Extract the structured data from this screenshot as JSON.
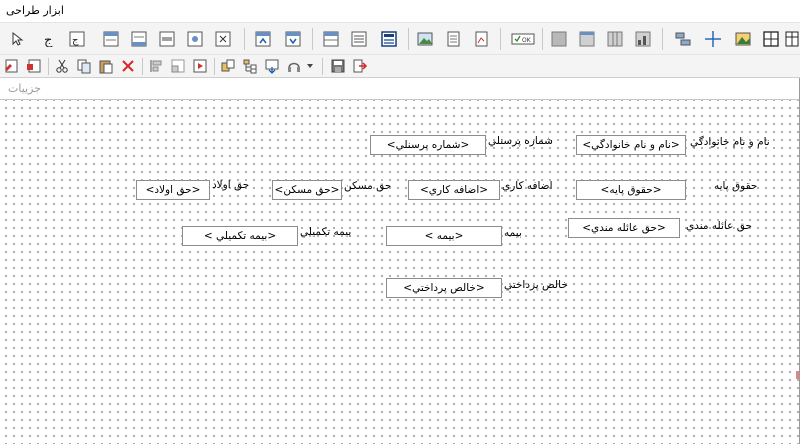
{
  "window": {
    "title": "ابزار طراحی"
  },
  "section": {
    "header": "جزییات"
  },
  "toolbar1": {
    "icons": [
      "pointer-icon",
      "label-icon",
      "textbox-icon",
      "band-header-icon",
      "band-footer-icon",
      "band-group-icon",
      "band-detail-icon",
      "band-summary-icon",
      "band-move-up-icon",
      "band-move-down-icon",
      "table-header-icon",
      "table-list-icon",
      "sub-report-icon",
      "picture-icon",
      "document-icon",
      "chart-icon",
      "checkbox-icon",
      "gray-box-icon",
      "frame-top-icon",
      "frame-columns-icon",
      "frame-bars-icon",
      "align-left-icon",
      "crosshair-icon",
      "image-icon",
      "grid-icon",
      "table-icon"
    ]
  },
  "toolbar2": {
    "icons": [
      "properties-icon",
      "report-settings-icon",
      "cut-icon",
      "copy-icon",
      "paste-icon",
      "delete-icon",
      "align-icon",
      "resize-icon",
      "preview-icon",
      "group-icon",
      "tree-icon",
      "import-icon",
      "headset-icon",
      "dropdown-icon",
      "save-icon",
      "exit-icon"
    ]
  },
  "report": {
    "labels": {
      "name": "نام و نام خانوادگي",
      "personnel_no": "شماره پرسنلي",
      "base_salary": "حقوق پايه",
      "overtime": "اضافه کاري",
      "housing": "حق مسکن",
      "child": "حق اولاد",
      "marital": "حق عائله مندي",
      "insurance": "بيمه",
      "supplementary": "بيمه تکميلي",
      "net_pay": "خالص پرداختي"
    },
    "fields": {
      "name": "<نام و نام خانوادگي>",
      "personnel_no": "<شماره پرسنلي>",
      "base_salary": "<حقوق پايه>",
      "overtime": "<اضافه کاري>",
      "housing": "<حق مسکن>",
      "child": "<حق اولاد>",
      "marital": "<حق عائله مندي>",
      "insurance": "<بيمه >",
      "supplementary": "<بيمه تکميلي >",
      "net_pay": "<خالص پرداختي>"
    }
  }
}
